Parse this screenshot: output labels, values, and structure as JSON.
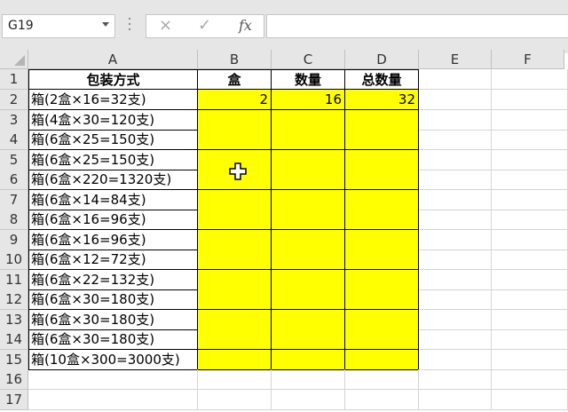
{
  "formula_bar": {
    "name_box": "G19",
    "cancel_icon": "×",
    "enter_icon": "✓",
    "fx_label": "fx",
    "formula": ""
  },
  "columns": [
    "A",
    "B",
    "C",
    "D",
    "E",
    "F"
  ],
  "rows": [
    "1",
    "2",
    "3",
    "4",
    "5",
    "6",
    "7",
    "8",
    "9",
    "10",
    "11",
    "12",
    "13",
    "14",
    "15",
    "16",
    "17"
  ],
  "headers": {
    "A": "包装方式",
    "B": "盒",
    "C": "数量",
    "D": "总数量"
  },
  "col_a": [
    "箱(2盒×16=32支)",
    "箱(4盒×30=120支)",
    "箱(6盒×25=150支)",
    "箱(6盒×25=150支)",
    "箱(6盒×220=1320支)",
    "箱(6盒×14=84支)",
    "箱(6盒×16=96支)",
    "箱(6盒×16=96支)",
    "箱(6盒×12=72支)",
    "箱(6盒×22=132支)",
    "箱(6盒×30=180支)",
    "箱(6盒×30=180支)",
    "箱(6盒×30=180支)",
    "箱(10盒×300=3000支)"
  ],
  "row2_values": {
    "B": "2",
    "C": "16",
    "D": "32"
  },
  "colors": {
    "highlight": "#ffff00",
    "header_bg": "#e6e6e6",
    "gridline": "#d4d4d4"
  }
}
